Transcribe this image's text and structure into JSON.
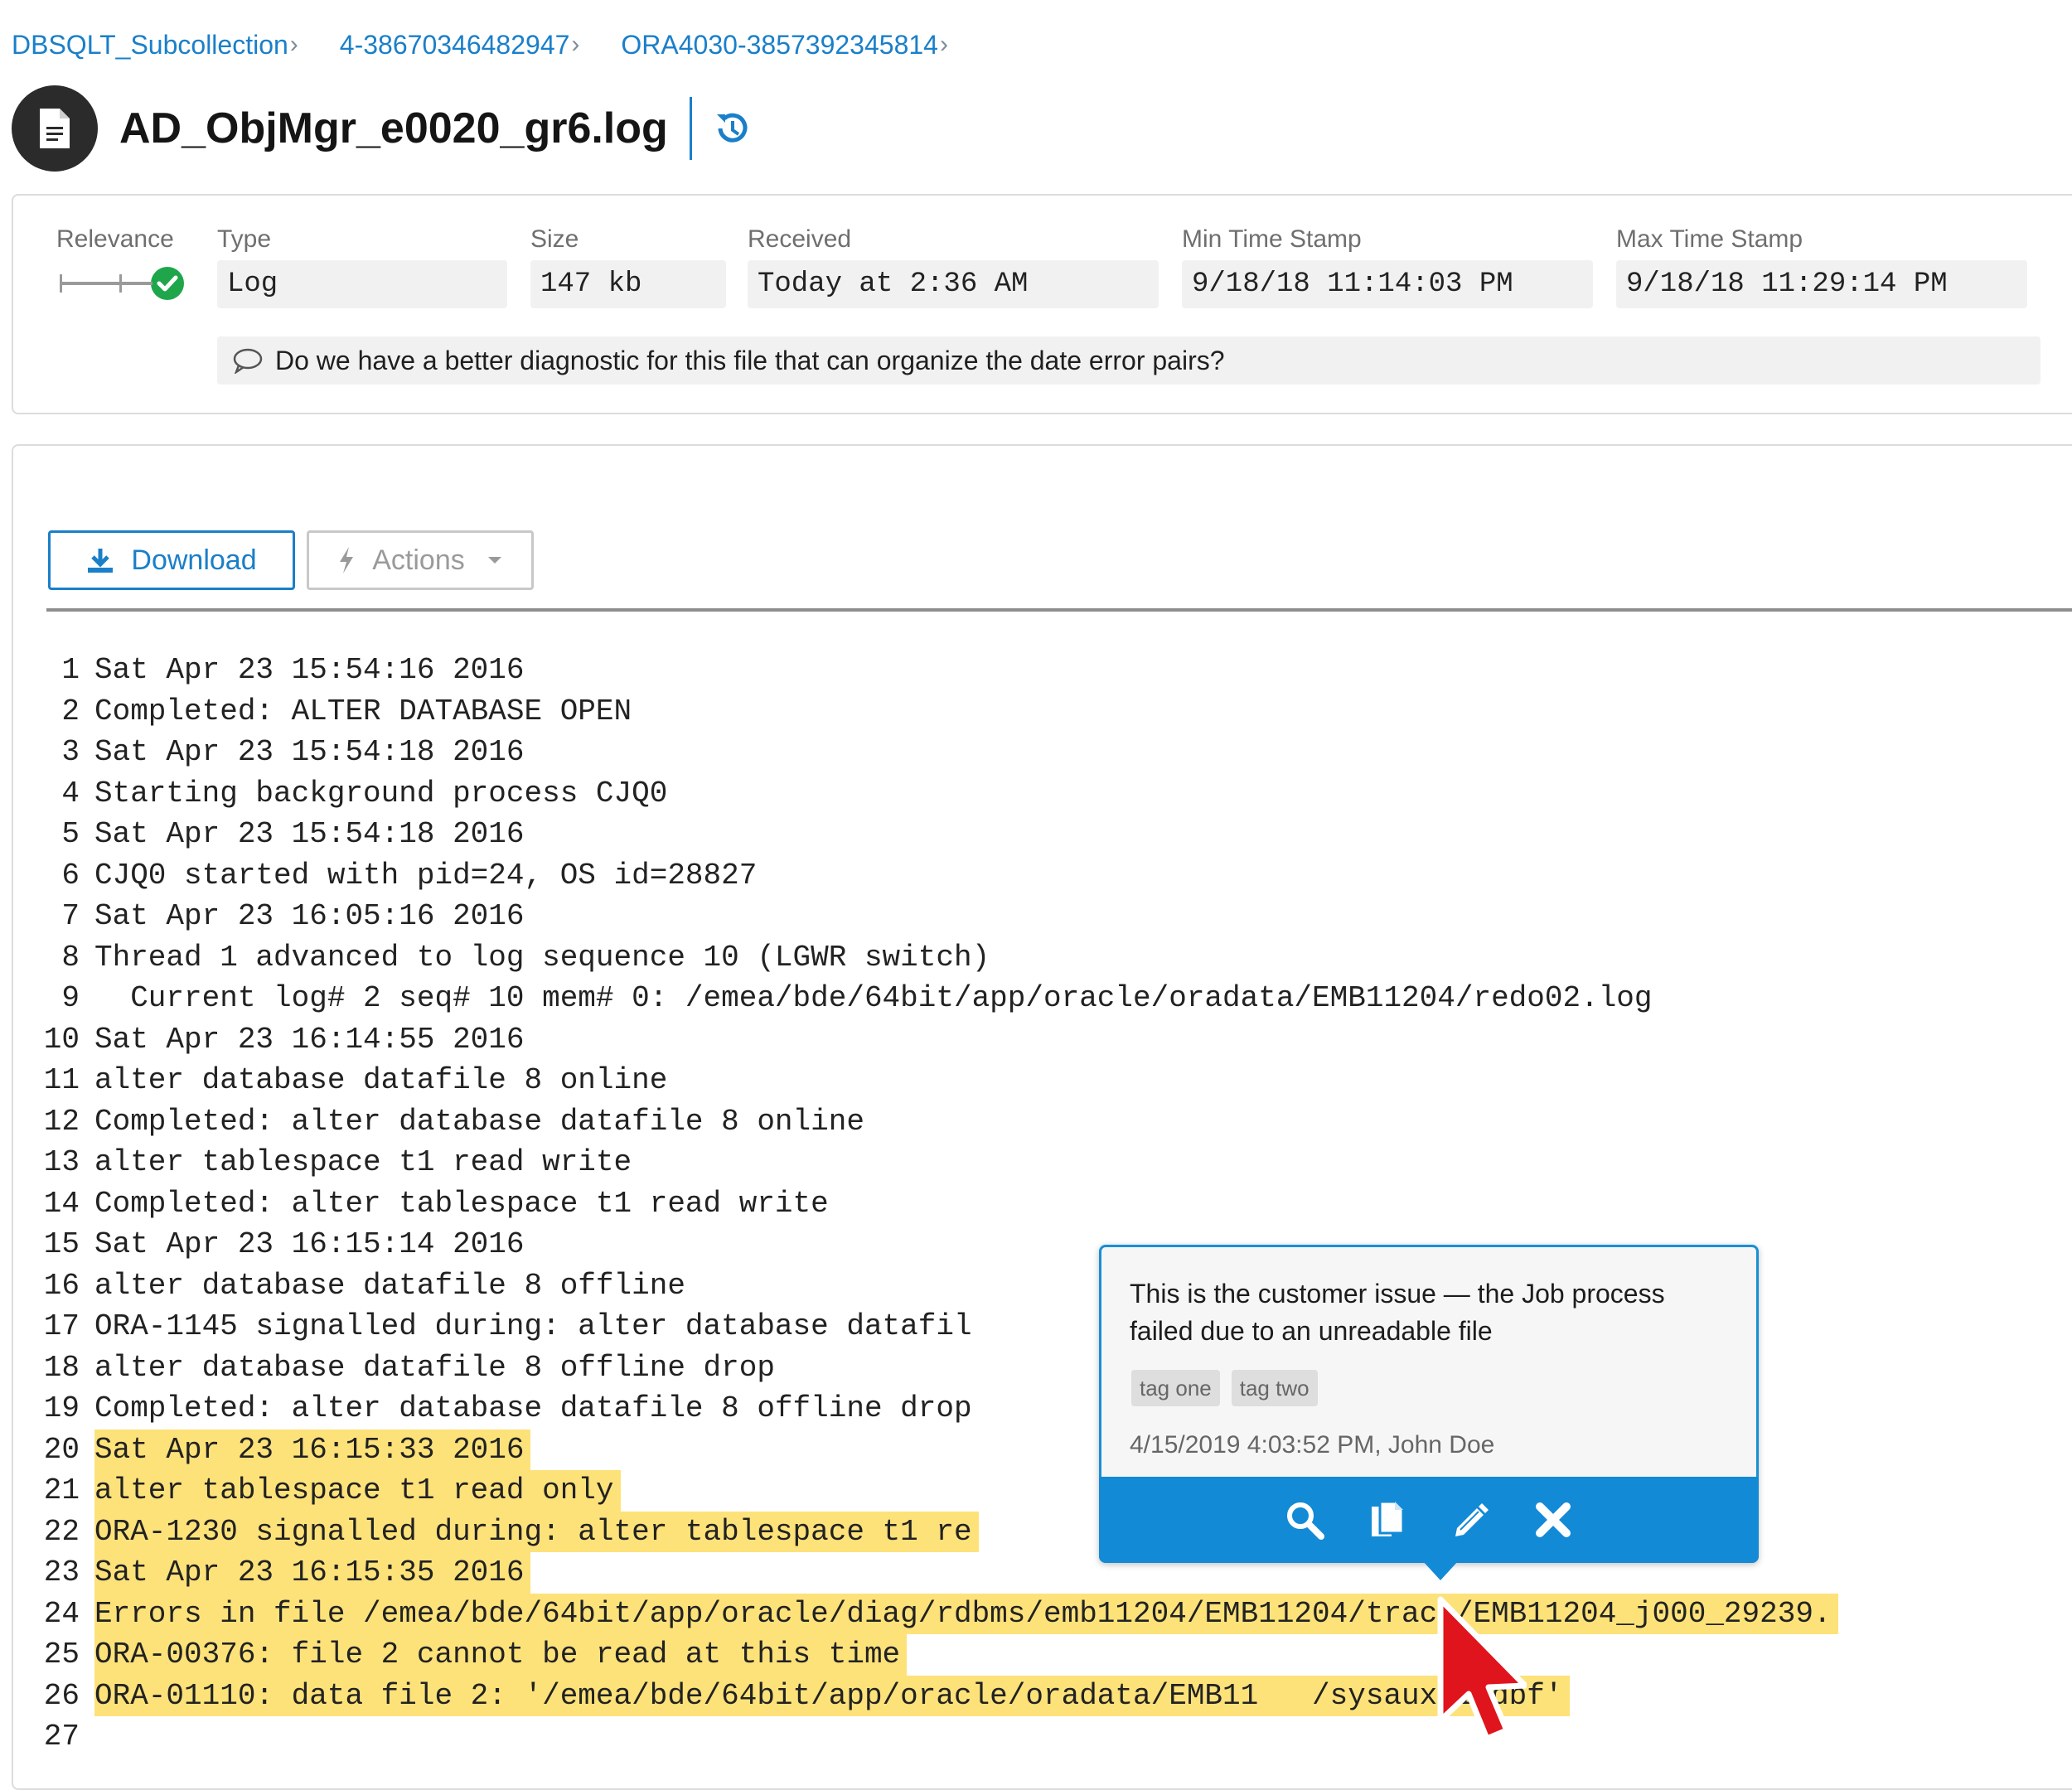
{
  "breadcrumb": [
    "DBSQLT_Subcollection",
    "4-38670346482947",
    "ORA4030-3857392345814"
  ],
  "file": {
    "title": "AD_ObjMgr_e0020_gr6.log",
    "icons": {
      "file": "document-icon",
      "history": "history-icon"
    }
  },
  "info": {
    "labels": {
      "relevance": "Relevance",
      "type": "Type",
      "size": "Size",
      "received": "Received",
      "min_ts": "Min Time Stamp",
      "max_ts": "Max Time Stamp"
    },
    "values": {
      "type": "Log",
      "size": "147 kb",
      "received": "Today at 2:36 AM",
      "min_ts": "9/18/18 11:14:03 PM",
      "max_ts": "9/18/18 11:29:14 PM"
    },
    "relevance_status": "check-icon",
    "comment": "Do we have a better diagnostic for this file that can organize the date error pairs?"
  },
  "toolbar": {
    "download_label": "Download",
    "actions_label": "Actions"
  },
  "log": {
    "highlighted_lines": [
      20,
      21,
      22,
      23,
      24,
      25,
      26
    ],
    "lines": [
      "Sat Apr 23 15:54:16 2016",
      "Completed: ALTER DATABASE OPEN",
      "Sat Apr 23 15:54:18 2016",
      "Starting background process CJQ0",
      "Sat Apr 23 15:54:18 2016",
      "CJQ0 started with pid=24, OS id=28827",
      "Sat Apr 23 16:05:16 2016",
      "Thread 1 advanced to log sequence 10 (LGWR switch)",
      "  Current log# 2 seq# 10 mem# 0: /emea/bde/64bit/app/oracle/oradata/EMB11204/redo02.log",
      "Sat Apr 23 16:14:55 2016",
      "alter database datafile 8 online",
      "Completed: alter database datafile 8 online",
      "alter tablespace t1 read write",
      "Completed: alter tablespace t1 read write",
      "Sat Apr 23 16:15:14 2016",
      "alter database datafile 8 offline",
      "ORA-1145 signalled during: alter database datafil",
      "alter database datafile 8 offline drop",
      "Completed: alter database datafile 8 offline drop",
      "Sat Apr 23 16:15:33 2016",
      "alter tablespace t1 read only",
      "ORA-1230 signalled during: alter tablespace t1 re",
      "Sat Apr 23 16:15:35 2016",
      "Errors in file /emea/bde/64bit/app/oracle/diag/rdbms/emb11204/EMB11204/trace/EMB11204_j000_29239.",
      "ORA-00376: file 2 cannot be read at this time",
      "ORA-01110: data file 2: '/emea/bde/64bit/app/oracle/oradata/EMB11   /sysaux01.dbf'",
      ""
    ]
  },
  "annotation": {
    "text": "This is the customer issue — the Job process failed due to an unreadable file",
    "tags": [
      "tag one",
      "tag two"
    ],
    "meta": "4/15/2019 4:03:52 PM, John Doe",
    "actions": [
      "search-icon",
      "copy-icon",
      "edit-icon",
      "close-icon"
    ]
  },
  "colors": {
    "accent": "#1a7fc9",
    "popover_bar": "#138ad6",
    "highlight": "#fde27a",
    "success": "#1fa64a"
  }
}
